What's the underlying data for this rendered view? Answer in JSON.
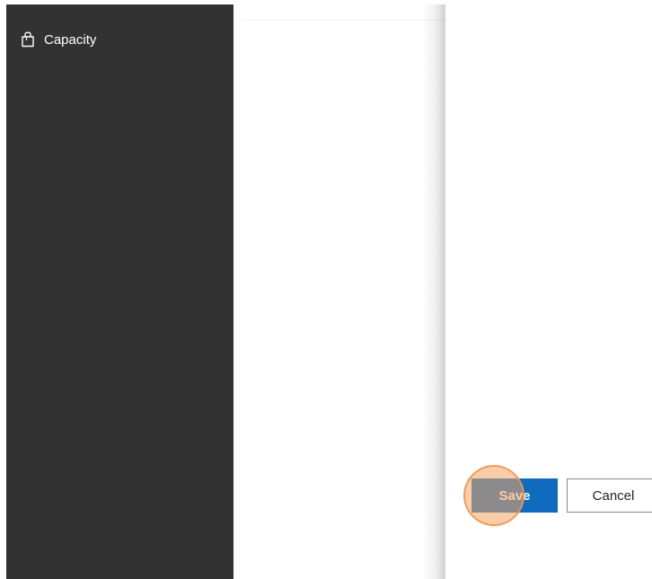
{
  "sidebar": {
    "items": [
      {
        "label": "Capacity",
        "icon": "shopping-bag-icon"
      }
    ]
  },
  "footer": {
    "save_label": "Save",
    "cancel_label": "Cancel"
  },
  "colors": {
    "sidebar_bg": "#323232",
    "primary_button": "#0f6cbd",
    "click_indicator": "#f4a460"
  }
}
